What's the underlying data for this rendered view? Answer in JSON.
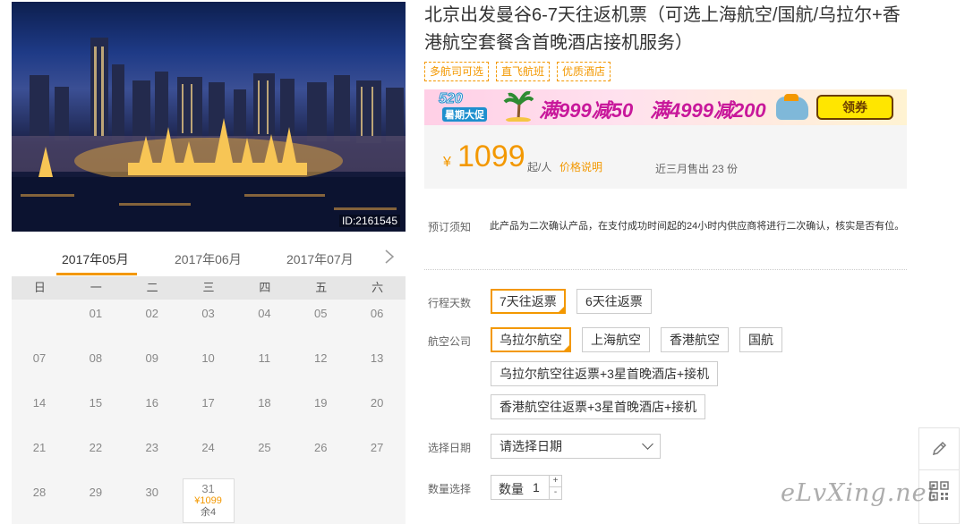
{
  "photo": {
    "id_label": "ID:2161545"
  },
  "calendar": {
    "tabs": [
      "2017年05月",
      "2017年06月",
      "2017年07月"
    ],
    "next_icon": "chevron-right-icon",
    "weekdays": [
      "日",
      "一",
      "二",
      "三",
      "四",
      "五",
      "六"
    ],
    "dates": [
      [
        "",
        "01",
        "02",
        "03",
        "04",
        "05",
        "06"
      ],
      [
        "07",
        "08",
        "09",
        "10",
        "11",
        "12",
        "13"
      ],
      [
        "14",
        "15",
        "16",
        "17",
        "18",
        "19",
        "20"
      ],
      [
        "21",
        "22",
        "23",
        "24",
        "25",
        "26",
        "27"
      ],
      [
        "28",
        "29",
        "30",
        "31",
        "",
        "",
        ""
      ]
    ],
    "available": {
      "date": "31",
      "price": "¥1099",
      "remain": "余4"
    }
  },
  "product": {
    "title": "北京出发曼谷6-7天往返机票（可选上海航空/国航/乌拉尔+香港航空套餐含首晚酒店接机服务）",
    "tags": [
      "多航司可选",
      "直飞航班",
      "优质酒店"
    ]
  },
  "banner": {
    "badge": "520",
    "badge_sub": "暑期大促",
    "offer1": "满999减50",
    "offer2": "满4999减200",
    "coupon_button": "领券"
  },
  "price": {
    "currency": "¥",
    "amount": "1099",
    "unit": "起/人",
    "explain_link": "价格说明",
    "sold": "近三月售出 23 份"
  },
  "notice": {
    "label": "预订须知",
    "text": "此产品为二次确认产品，在支付成功时间起的24小时内供应商将进行二次确认，核实是否有位。"
  },
  "options": {
    "days_label": "行程天数",
    "days": [
      "7天往返票",
      "6天往返票"
    ],
    "airline_label": "航空公司",
    "airlines": [
      "乌拉尔航空",
      "上海航空",
      "香港航空",
      "国航"
    ],
    "packages": [
      "乌拉尔航空往返票+3星首晚酒店+接机",
      "香港航空往返票+3星首晚酒店+接机"
    ],
    "date_label": "选择日期",
    "date_placeholder": "请选择日期",
    "qty_label": "数量选择",
    "qty_text": "数量",
    "qty_value": "1",
    "plus": "+",
    "minus": "-"
  },
  "side": {
    "edit_icon": "pencil-icon",
    "qr_icon": "qrcode-icon"
  },
  "watermark": "eLvXing.net",
  "colors": {
    "accent": "#f39800",
    "banner_text": "#c8189b"
  }
}
